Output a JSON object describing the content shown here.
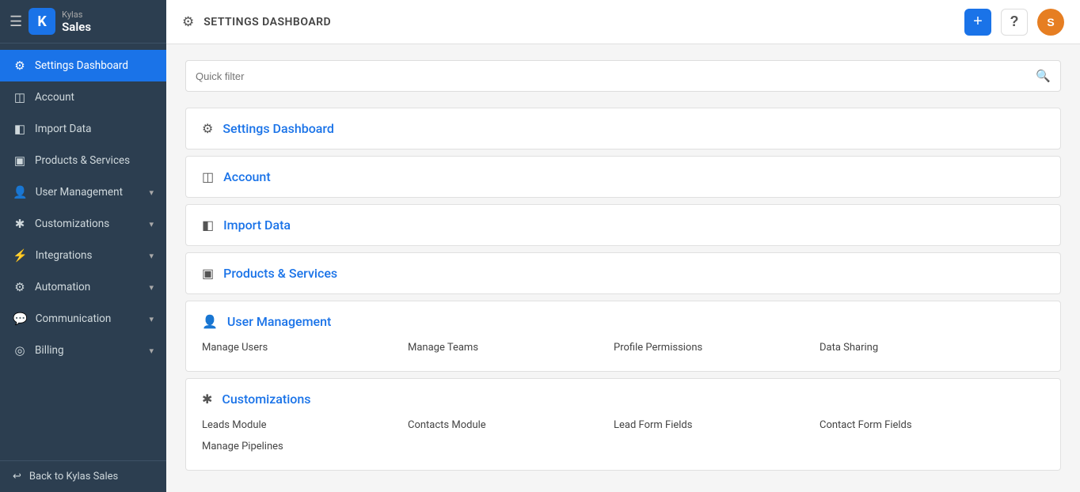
{
  "brand": {
    "company": "Kylas",
    "product": "Sales"
  },
  "topbar": {
    "title": "SETTINGS DASHBOARD",
    "add_label": "+",
    "help_label": "?",
    "avatar_label": "S"
  },
  "sidebar": {
    "items": [
      {
        "id": "settings-dashboard",
        "label": "Settings Dashboard",
        "icon": "⚙",
        "active": true,
        "has_chevron": false
      },
      {
        "id": "account",
        "label": "Account",
        "icon": "▦",
        "active": false,
        "has_chevron": false
      },
      {
        "id": "import-data",
        "label": "Import Data",
        "icon": "▤",
        "active": false,
        "has_chevron": false
      },
      {
        "id": "products-services",
        "label": "Products & Services",
        "icon": "▣",
        "active": false,
        "has_chevron": false
      },
      {
        "id": "user-management",
        "label": "User Management",
        "icon": "👥",
        "active": false,
        "has_chevron": true
      },
      {
        "id": "customizations",
        "label": "Customizations",
        "icon": "✂",
        "active": false,
        "has_chevron": true
      },
      {
        "id": "integrations",
        "label": "Integrations",
        "icon": "🔗",
        "active": false,
        "has_chevron": true
      },
      {
        "id": "automation",
        "label": "Automation",
        "icon": "⚙",
        "active": false,
        "has_chevron": true
      },
      {
        "id": "communication",
        "label": "Communication",
        "icon": "💬",
        "active": false,
        "has_chevron": true
      },
      {
        "id": "billing",
        "label": "Billing",
        "icon": "◉",
        "active": false,
        "has_chevron": true
      }
    ],
    "footer": {
      "label": "Back to Kylas Sales",
      "icon": "↩"
    }
  },
  "filter": {
    "placeholder": "Quick filter"
  },
  "sections": [
    {
      "id": "settings-dashboard",
      "title": "Settings Dashboard",
      "icon": "⚙",
      "sub_items": []
    },
    {
      "id": "account",
      "title": "Account",
      "icon": "▦",
      "sub_items": []
    },
    {
      "id": "import-data",
      "title": "Import Data",
      "icon": "▤",
      "sub_items": []
    },
    {
      "id": "products-services",
      "title": "Products & Services",
      "icon": "▣",
      "sub_items": []
    },
    {
      "id": "user-management",
      "title": "User Management",
      "icon": "👥",
      "sub_items": [
        "Manage Users",
        "Manage Teams",
        "Profile Permissions",
        "Data Sharing"
      ]
    },
    {
      "id": "customizations",
      "title": "Customizations",
      "icon": "✂",
      "sub_items": [
        "Leads Module",
        "Contacts Module",
        "Lead Form Fields",
        "Contact Form Fields",
        "Manage Pipelines"
      ]
    }
  ]
}
